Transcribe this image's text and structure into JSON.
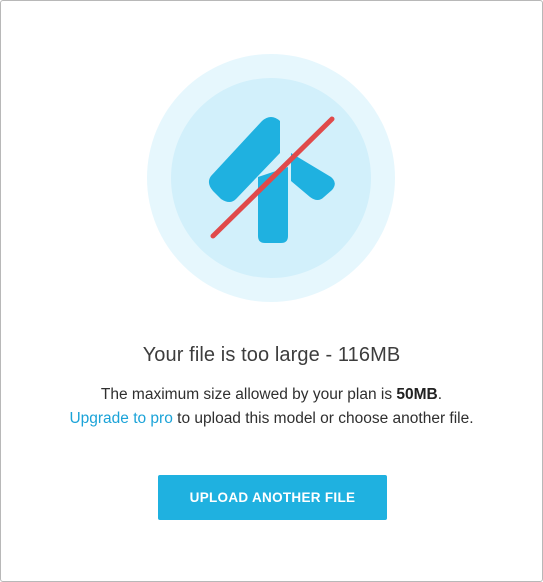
{
  "dialog": {
    "illustration_icon": "upload-arrow-crossed-icon",
    "title": "Your file is too large - 116MB",
    "limit_prefix": "The maximum size allowed by your plan is ",
    "limit_value": "50MB",
    "limit_suffix": ".",
    "upgrade_link": "Upgrade to pro",
    "upgrade_suffix": " to upload this model or choose another file.",
    "upload_button": "UPLOAD ANOTHER FILE"
  },
  "colors": {
    "accent": "#1fb1e0",
    "link": "#1ba3d8",
    "strike": "#e04a4a",
    "circle_outer": "#e6f7fd",
    "circle_inner": "#d2f0fb"
  }
}
